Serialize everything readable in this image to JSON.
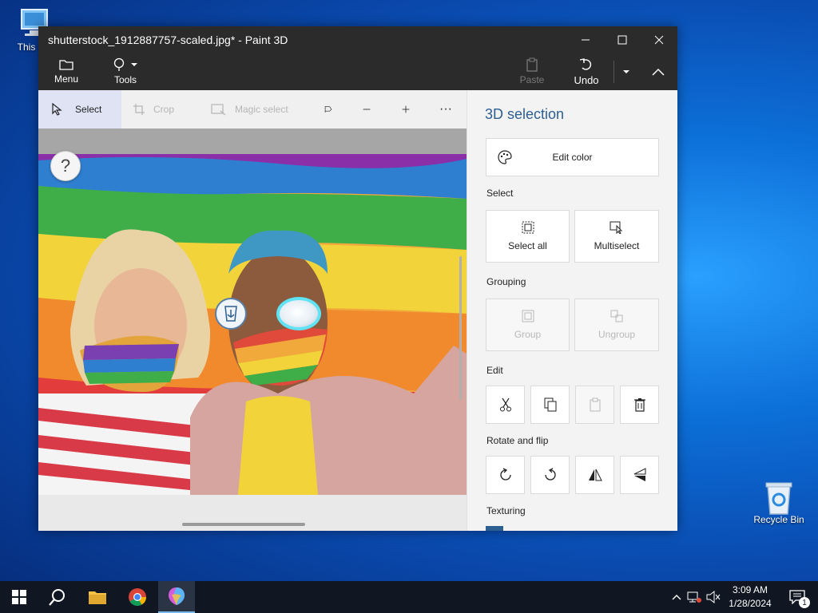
{
  "desktop": {
    "this_pc_label": "This PC",
    "recycle_bin_label": "Recycle Bin"
  },
  "window": {
    "title": "shutterstock_1912887757-scaled.jpg* - Paint 3D",
    "app_name": "Paint 3D"
  },
  "toolbar": {
    "menu_label": "Menu",
    "tools_label": "Tools",
    "paste_label": "Paste",
    "undo_label": "Undo"
  },
  "ribbon": {
    "select_label": "Select",
    "crop_label": "Crop",
    "magic_select_label": "Magic select",
    "more_label": "···"
  },
  "canvas": {
    "help_label": "?"
  },
  "panel": {
    "title": "3D selection",
    "edit_color_label": "Edit color",
    "select_section": "Select",
    "select_all_label": "Select all",
    "multiselect_label": "Multiselect",
    "grouping_section": "Grouping",
    "group_label": "Group",
    "ungroup_label": "Ungroup",
    "edit_section": "Edit",
    "rotate_section": "Rotate and flip",
    "texturing_section": "Texturing"
  },
  "taskbar": {
    "time": "3:09 AM",
    "date": "1/28/2024",
    "notification_count": "1"
  },
  "colors": {
    "titlebar": "#2b2b2b",
    "accent": "#2d5f91",
    "selection_ring": "#5fe3f5"
  }
}
